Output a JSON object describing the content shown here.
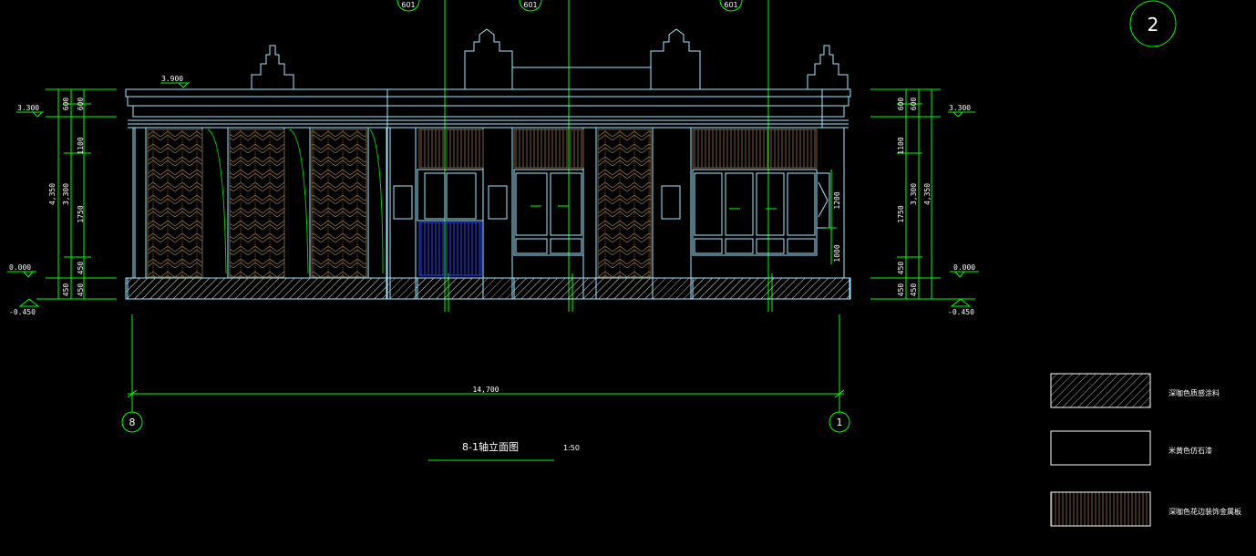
{
  "drawing": {
    "sheet_number": "2",
    "title": "8-1轴立面图",
    "scale": "1:50",
    "detail_refs": [
      "601",
      "601",
      "601"
    ],
    "axes": {
      "left": "8",
      "right": "1"
    },
    "overall_width": "14,700",
    "levels": {
      "roof": "3.900",
      "eave_left": "3.300",
      "eave_right": "3.300",
      "ground_left": "0.000",
      "ground_right": "0.000",
      "base_left": "-0.450",
      "base_right": "-0.450"
    },
    "left_dims": {
      "outer": "4,350",
      "mid": "3,300",
      "seg": [
        "600",
        "600",
        "1100",
        "1750",
        "450",
        "450",
        "450"
      ]
    },
    "right_dims": {
      "outer": "4,350",
      "mid": "3,300",
      "seg": [
        "600",
        "600",
        "1100",
        "1750",
        "450",
        "450",
        "450"
      ]
    },
    "window_dims": [
      "1200",
      "1000"
    ]
  },
  "legend": [
    {
      "pattern": "hatch",
      "label": "深咖色质感涂料"
    },
    {
      "pattern": "blank",
      "label": "米黄色仿石漆"
    },
    {
      "pattern": "grille",
      "label": "深咖色花边装饰金属板"
    }
  ],
  "colors": {
    "background": "#000000",
    "outline": "#9fe8ff",
    "dimension": "#00ff00",
    "grille": "#7a5a3a",
    "blue_panel": "#2a46ff",
    "text": "#ffffff"
  }
}
